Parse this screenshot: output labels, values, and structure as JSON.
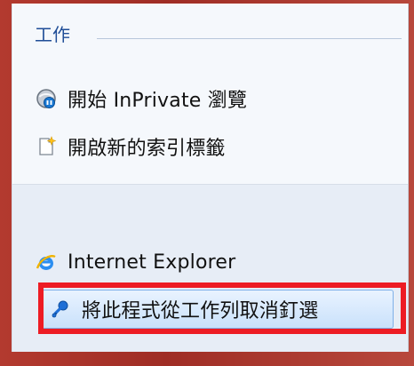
{
  "section": {
    "title": "工作"
  },
  "items": [
    {
      "label": "開始 InPrivate 瀏覽",
      "icon": "inprivate-icon"
    },
    {
      "label": "開啟新的索引標籤",
      "icon": "new-tab-icon"
    },
    {
      "label": "Internet Explorer",
      "icon": "internet-explorer-icon"
    },
    {
      "label": "將此程式從工作列取消釘選",
      "icon": "unpin-icon"
    }
  ],
  "colors": {
    "window_border": "#a8352b",
    "section_title": "#1f4d97",
    "highlight": "#ed1c24"
  }
}
